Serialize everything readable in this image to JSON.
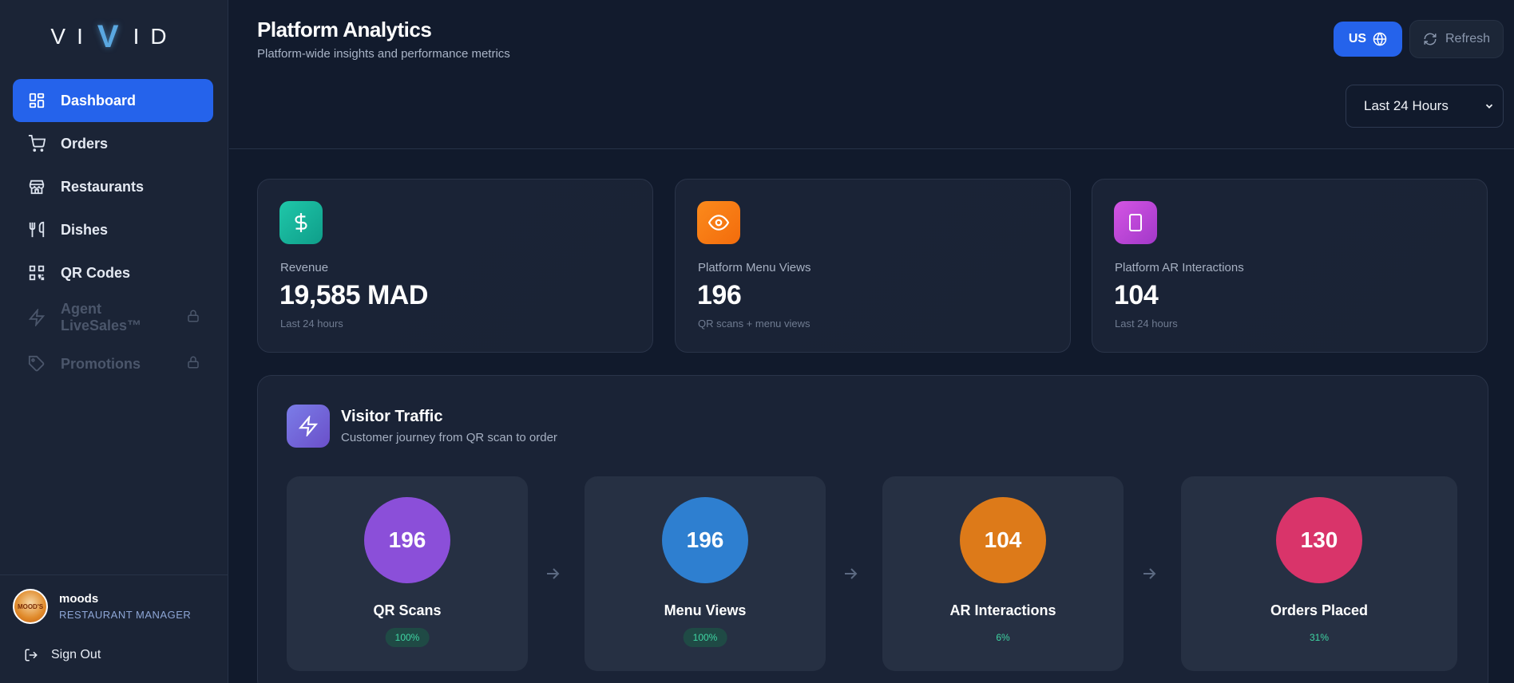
{
  "brand": {
    "logo_left": "VI",
    "logo_mid": "V",
    "logo_right": "ID"
  },
  "sidebar": {
    "items": [
      {
        "label": "Dashboard",
        "icon": "grid-icon",
        "active": true
      },
      {
        "label": "Orders",
        "icon": "cart-icon"
      },
      {
        "label": "Restaurants",
        "icon": "store-icon"
      },
      {
        "label": "Dishes",
        "icon": "utensils-icon"
      },
      {
        "label": "QR Codes",
        "icon": "qr-code-icon"
      },
      {
        "label": "Agent LiveSales™",
        "icon": "lightning-icon",
        "locked": true
      },
      {
        "label": "Promotions",
        "icon": "tag-icon",
        "locked": true
      }
    ],
    "user": {
      "name": "moods",
      "role": "RESTAURANT MANAGER",
      "avatar_text": "MOOD'S"
    },
    "signout_label": "Sign Out"
  },
  "header": {
    "title": "Platform Analytics",
    "subtitle": "Platform-wide insights and performance metrics",
    "lang_label": "US",
    "refresh_label": "Refresh",
    "range_selected": "Last 24 Hours"
  },
  "stats": [
    {
      "label": "Revenue",
      "value": "19,585 MAD",
      "note": "Last 24 hours",
      "icon": "dollar-icon",
      "color": "#14b8a6"
    },
    {
      "label": "Platform Menu Views",
      "value": "196",
      "note": "QR scans + menu views",
      "icon": "eye-icon",
      "color": "#f97316"
    },
    {
      "label": "Platform AR Interactions",
      "value": "104",
      "note": "Last 24 hours",
      "icon": "tablet-icon",
      "color": "#c046d6"
    }
  ],
  "traffic": {
    "title": "Visitor Traffic",
    "subtitle": "Customer journey from QR scan to order",
    "steps": [
      {
        "value": "196",
        "label": "QR Scans",
        "pct": "100%",
        "color": "#8b4fd9"
      },
      {
        "value": "196",
        "label": "Menu Views",
        "pct": "100%",
        "color": "#2e7fd0"
      },
      {
        "value": "104",
        "label": "AR Interactions",
        "pct": "6%",
        "color": "#dd7a19"
      },
      {
        "value": "130",
        "label": "Orders Placed",
        "pct": "31%",
        "color": "#d9346a"
      }
    ]
  },
  "colors": {
    "accent": "#2563eb",
    "success": "#3fd5a3",
    "background": "#111a2c",
    "sidebar": "#1b2436"
  }
}
